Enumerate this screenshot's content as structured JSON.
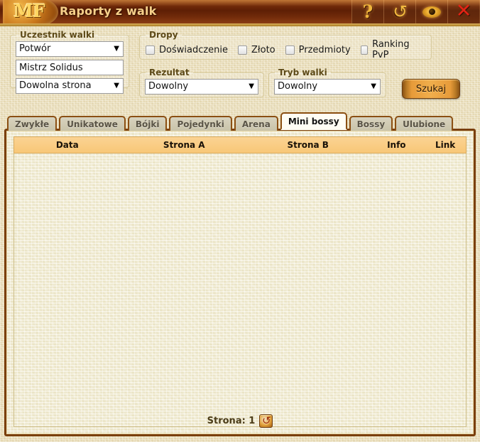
{
  "window": {
    "logo_text": "MF",
    "title": "Raporty z walk",
    "buttons": [
      {
        "name": "help-button",
        "icon": "question-mark-icon",
        "glyph": "?"
      },
      {
        "name": "refresh-button",
        "icon": "refresh-icon",
        "glyph": "↻"
      },
      {
        "name": "eye-button",
        "icon": "eye-icon",
        "glyph": ""
      },
      {
        "name": "close-button",
        "icon": "close-icon",
        "glyph": "✕"
      }
    ]
  },
  "form": {
    "participant": {
      "legend": "Uczestnik walki",
      "type_select": {
        "value": "Potwór",
        "arrow": "▼"
      },
      "name_input": {
        "value": "Mistrz Solidus",
        "placeholder": ""
      },
      "side_select": {
        "value": "Dowolna strona",
        "arrow": "▼"
      }
    },
    "drops": {
      "legend": "Dropy",
      "items": [
        {
          "label": "Doświadczenie",
          "checked": false
        },
        {
          "label": "Złoto",
          "checked": false
        },
        {
          "label": "Przedmioty",
          "checked": false
        },
        {
          "label": "Ranking PvP",
          "checked": false
        }
      ]
    },
    "result": {
      "legend": "Rezultat",
      "select": {
        "value": "Dowolny",
        "arrow": "▼"
      }
    },
    "mode": {
      "legend": "Tryb walki",
      "select": {
        "value": "Dowolny",
        "arrow": "▼"
      }
    },
    "search_button": "Szukaj"
  },
  "tabs": [
    {
      "label": "Zwykłe",
      "active": false
    },
    {
      "label": "Unikatowe",
      "active": false
    },
    {
      "label": "Bójki",
      "active": false
    },
    {
      "label": "Pojedynki",
      "active": false
    },
    {
      "label": "Arena",
      "active": false
    },
    {
      "label": "Mini bossy",
      "active": true
    },
    {
      "label": "Bossy",
      "active": false
    },
    {
      "label": "Ulubione",
      "active": false
    }
  ],
  "table": {
    "columns": [
      "Data",
      "Strona A",
      "Strona B",
      "Info",
      "Link"
    ],
    "rows": []
  },
  "footer": {
    "page_label": "Strona: 1",
    "refresh_glyph": "↻"
  },
  "colors": {
    "titlebar_brown": "#5e1f05",
    "title_gold": "#f6d08a",
    "panel_border": "#7a3f0d",
    "paper": "#f6f1da",
    "outer_bg": "#ece0bb",
    "table_header": "#f8c777",
    "button_orange": "#f0ae4c",
    "close_red": "#e32314",
    "tab_inactive": "#d0caaf",
    "tab_active": "#fffdf4"
  }
}
